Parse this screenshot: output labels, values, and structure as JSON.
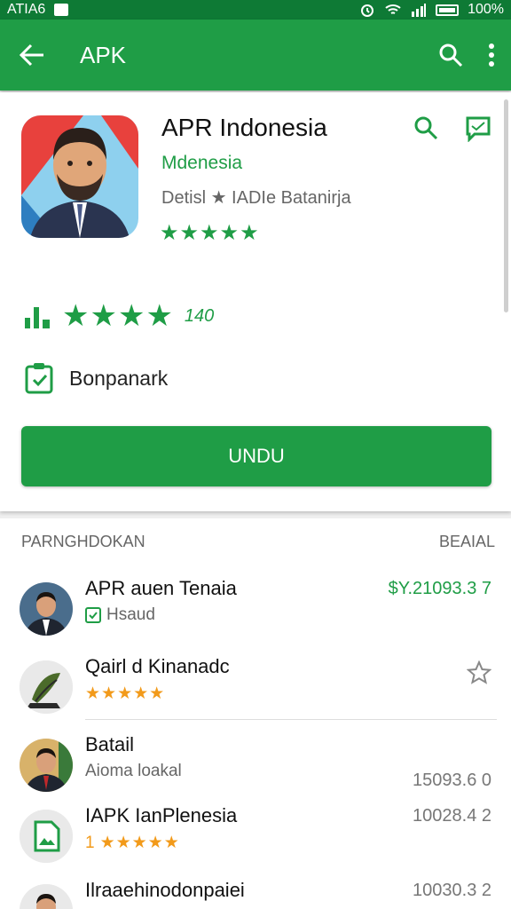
{
  "status_bar": {
    "carrier": "ATIA6",
    "battery": "100%"
  },
  "app_bar": {
    "title": "APK"
  },
  "app": {
    "title": "APR Indonesia",
    "subtitle": "Mdenesia",
    "developer": "Detisl ★ IADIe Batanirja",
    "stars": "★★★★★",
    "rating_stars": "★★★★",
    "rating_count": "140",
    "bookmark_label": "Bonpanark",
    "install_label": "UNDU"
  },
  "list": {
    "header_left": "PARNGHDOKAN",
    "header_right": "BEAIAL",
    "items": [
      {
        "name": "APR auen Tenaia",
        "sub": "Hsaud",
        "price": "$Y.21093.3 7",
        "price_color": "#1f9d46"
      },
      {
        "name": "Qairl d Kinanadc",
        "sub_stars": "★★★★★",
        "price": ""
      },
      {
        "name": "Batail",
        "sub": "Aioma loakal",
        "price": "15093.6 0"
      },
      {
        "name": "IAPK IanPlenesia",
        "sub_prefix": "1",
        "sub_stars": "★★★★★",
        "price": "10028.4 2"
      },
      {
        "name": "Ilraaehinodonpaiei",
        "sub": "",
        "price": "10030.3 2"
      }
    ]
  },
  "colors": {
    "primary": "#1f9d46",
    "status_bar": "#0e7a35",
    "rating_orange": "#f29a1a"
  }
}
